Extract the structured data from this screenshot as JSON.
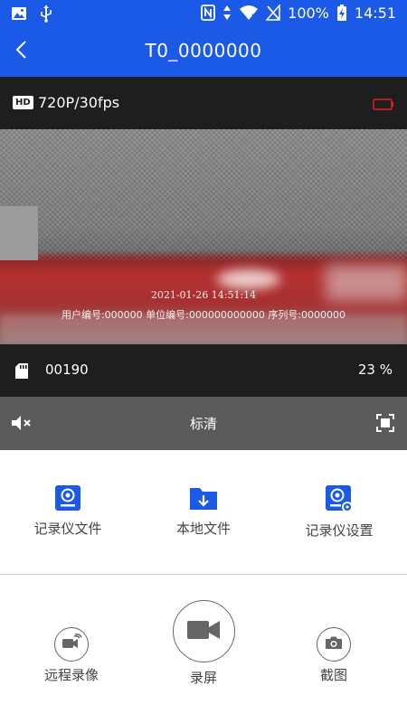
{
  "status_bar": {
    "battery_level": "100%",
    "time": "14:51",
    "icons": [
      "image-icon",
      "usb-icon",
      "nfc-icon",
      "data-arrows-icon",
      "wifi-icon",
      "no-signal-icon",
      "battery-charging-icon"
    ]
  },
  "header": {
    "title": "T0_0000000",
    "back_icon": "chevron-left-icon"
  },
  "video_info": {
    "hd_badge": "HD",
    "resolution": "720P/30fps",
    "battery_icon": "device-battery-low-icon",
    "battery_color": "#e02020"
  },
  "video_overlay": {
    "timestamp": "2021-01-26 14:51:14",
    "ids_line": "用户编号:000000 单位编号:000000000000 序列号:0000000"
  },
  "storage": {
    "sd_icon": "sd-card-icon",
    "file_count": "00190",
    "percent": "23 %"
  },
  "controls": {
    "mute_icon": "speaker-muted-icon",
    "quality": "标清",
    "fullscreen_icon": "fullscreen-icon"
  },
  "features": [
    {
      "label": "记录仪文件",
      "icon": "recorder-files-icon"
    },
    {
      "label": "本地文件",
      "icon": "download-folder-icon"
    },
    {
      "label": "记录仪设置",
      "icon": "recorder-settings-icon"
    }
  ],
  "actions": {
    "remote_record": {
      "label": "远程录像",
      "icon": "remote-video-icon"
    },
    "screen_record": {
      "label": "录屏",
      "icon": "video-camera-icon"
    },
    "screenshot": {
      "label": "截图",
      "icon": "camera-icon"
    }
  },
  "colors": {
    "primary": "#1a5ae6",
    "dark_bar": "#1e1e1e",
    "control_bar": "#5a5a5a"
  }
}
